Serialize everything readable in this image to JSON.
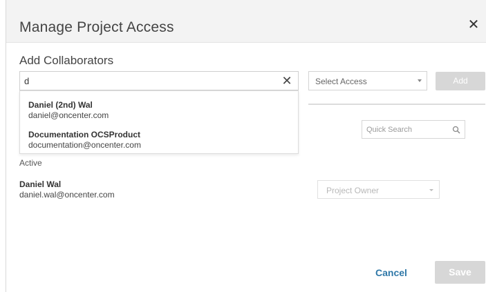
{
  "modal": {
    "title": "Manage Project Access",
    "close_icon": "close-icon"
  },
  "add_collaborators": {
    "heading": "Add Collaborators",
    "search": {
      "value": "d",
      "clear_icon": "close-icon"
    },
    "access_select": {
      "selected": "Select Access"
    },
    "add_label": "Add",
    "suggestions": [
      {
        "name": "Daniel (2nd) Wal",
        "email": "daniel@oncenter.com"
      },
      {
        "name": "Documentation OCSProduct",
        "email": "documentation@oncenter.com"
      }
    ]
  },
  "members": {
    "quick_search_placeholder": "Quick Search",
    "status_label": "Active",
    "rows": [
      {
        "name": "Daniel Wal",
        "email": "daniel.wal@oncenter.com",
        "role": "Project Owner"
      }
    ]
  },
  "footer": {
    "cancel_label": "Cancel",
    "save_label": "Save"
  },
  "colors": {
    "accent": "#2f78a8",
    "disabled_button": "#d7d7d7",
    "header_bg": "#f3f3f3"
  }
}
